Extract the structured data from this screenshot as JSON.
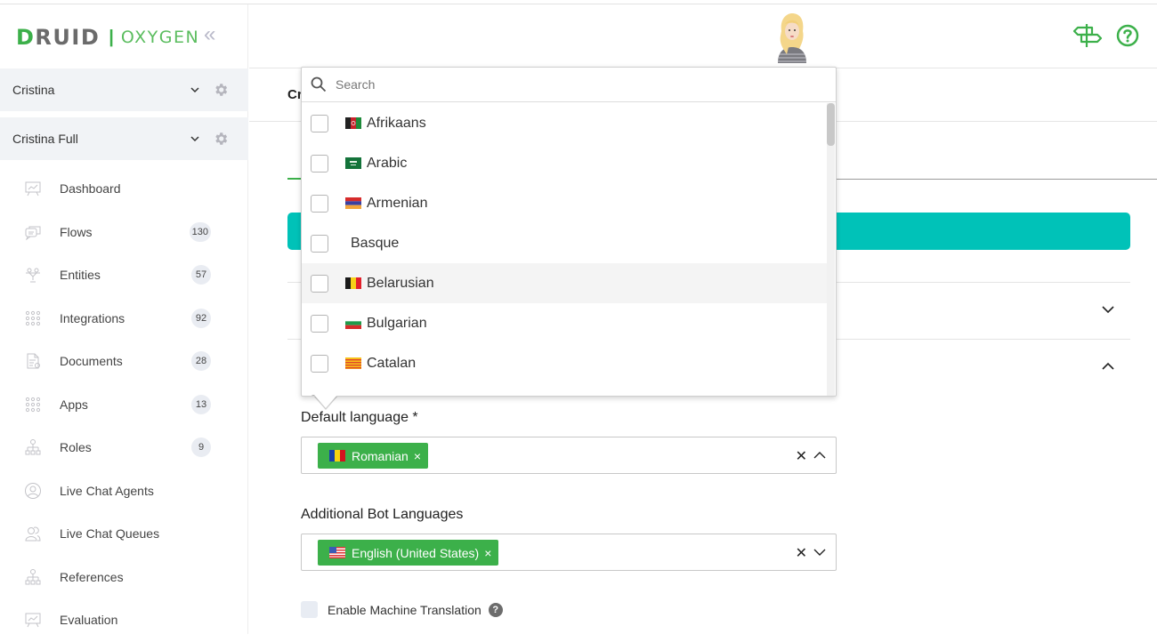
{
  "brand": {
    "name": "DRUID",
    "product": "OXYGEN",
    "accent": "#3cb04a"
  },
  "sidebar": {
    "accounts": [
      {
        "name": "Cristina"
      },
      {
        "name": "Cristina Full"
      }
    ],
    "items": [
      {
        "label": "Dashboard",
        "icon": "presentation-chart-icon",
        "count": null
      },
      {
        "label": "Flows",
        "icon": "chat-bubbles-icon",
        "count": "130"
      },
      {
        "label": "Entities",
        "icon": "entities-icon",
        "count": "57"
      },
      {
        "label": "Integrations",
        "icon": "dots-grid-icon",
        "count": "92"
      },
      {
        "label": "Documents",
        "icon": "document-icon",
        "count": "28"
      },
      {
        "label": "Apps",
        "icon": "dots-grid-icon",
        "count": "13"
      },
      {
        "label": "Roles",
        "icon": "hierarchy-icon",
        "count": "9"
      },
      {
        "label": "Live Chat Agents",
        "icon": "user-circle-icon",
        "count": null
      },
      {
        "label": "Live Chat Queues",
        "icon": "users-icon",
        "count": null
      },
      {
        "label": "References",
        "icon": "hierarchy-icon",
        "count": null
      },
      {
        "label": "Evaluation",
        "icon": "presentation-chart-icon",
        "count": null
      }
    ]
  },
  "main": {
    "page_title": "Cr",
    "banner_color": "#00c2b8",
    "default_language": {
      "label": "Default language *",
      "selected": [
        {
          "label": "Romanian",
          "flag": "ro"
        }
      ]
    },
    "additional_languages": {
      "label": "Additional Bot Languages",
      "selected": [
        {
          "label": "English (United States)",
          "flag": "us"
        }
      ]
    },
    "machine_translation": {
      "label": "Enable Machine Translation",
      "checked": false,
      "help": "?"
    }
  },
  "dropdown": {
    "search_placeholder": "Search",
    "options": [
      {
        "label": "Afrikaans",
        "flag": "af",
        "checked": false
      },
      {
        "label": "Arabic",
        "flag": "sa",
        "checked": false
      },
      {
        "label": "Armenian",
        "flag": "am",
        "checked": false
      },
      {
        "label": "Basque",
        "flag": "",
        "checked": false
      },
      {
        "label": "Belarusian",
        "flag": "be",
        "checked": false,
        "hovered": true
      },
      {
        "label": "Bulgarian",
        "flag": "bg",
        "checked": false
      },
      {
        "label": "Catalan",
        "flag": "ca",
        "checked": false
      }
    ]
  }
}
